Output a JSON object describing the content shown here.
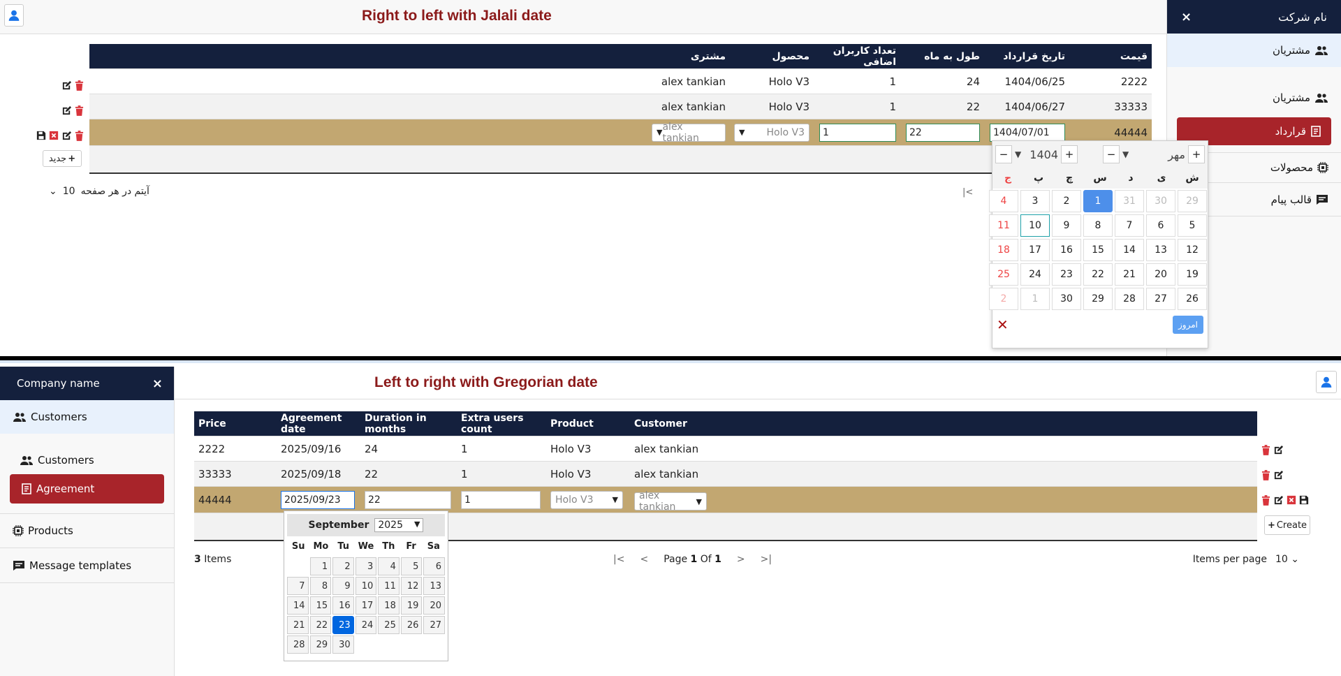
{
  "top": {
    "title": "Right to left with Jalali date",
    "sidebar": {
      "company": "نام شرکت",
      "close": "×",
      "nav_customers": "مشتریان",
      "sub_customers": "مشتریان",
      "sub_agreement": "قرارداد",
      "nav_products": "محصولات",
      "nav_messages": "قالب پیام"
    },
    "grid": {
      "headers": [
        "قیمت",
        "تاریخ قرارداد",
        "طول به ماه",
        "تعداد کاربران اضافی",
        "محصول",
        "مشتری"
      ],
      "rows": [
        [
          "2222",
          "1404/06/25",
          "24",
          "1",
          "Holo V3",
          "alex tankian"
        ],
        [
          "33333",
          "1404/06/27",
          "22",
          "1",
          "Holo V3",
          "alex tankian"
        ]
      ],
      "edit": {
        "price": "44444",
        "date": "1404/07/01",
        "duration": "22",
        "extra": "1",
        "product": "Holo V3",
        "customer": "alex tankian"
      }
    },
    "new_button": "جدید",
    "items_per_page_label": "آیتم در هر صفحه",
    "items_per_page": "10",
    "picker": {
      "month": "مهر",
      "year": "1404",
      "days": [
        "ش",
        "ی",
        "د",
        "س",
        "چ",
        "پ",
        "ج"
      ],
      "today": "امروز",
      "close": "✕",
      "weeks": [
        [
          "29",
          "30",
          "31",
          "1",
          "2",
          "3",
          "4"
        ],
        [
          "5",
          "6",
          "7",
          "8",
          "9",
          "10",
          "11"
        ],
        [
          "12",
          "13",
          "14",
          "15",
          "16",
          "17",
          "18"
        ],
        [
          "19",
          "20",
          "21",
          "22",
          "23",
          "24",
          "25"
        ],
        [
          "26",
          "27",
          "28",
          "29",
          "30",
          "1",
          "2"
        ]
      ]
    }
  },
  "bottom": {
    "title": "Left to right with Gregorian date",
    "sidebar": {
      "company": "Company name",
      "close": "×",
      "nav_customers": "Customers",
      "sub_customers": "Customers",
      "sub_agreement": "Agreement",
      "nav_products": "Products",
      "nav_messages": "Message templates"
    },
    "grid": {
      "headers": [
        "Price",
        "Agreement date",
        "Duration in months",
        "Extra users count",
        "Product",
        "Customer"
      ],
      "rows": [
        [
          "2222",
          "2025/09/16",
          "24",
          "1",
          "Holo V3",
          "alex tankian"
        ],
        [
          "33333",
          "2025/09/18",
          "22",
          "1",
          "Holo V3",
          "alex tankian"
        ]
      ],
      "edit": {
        "price": "44444",
        "date": "2025/09/23",
        "duration": "22",
        "extra": "1",
        "product": "Holo V3",
        "customer": "alex tankian"
      }
    },
    "create_button": "Create",
    "pager": {
      "count": "3",
      "items_label": "Items",
      "page_label": "Page",
      "page": "1",
      "of_label": "Of",
      "pages": "1",
      "ipp_label": "Items per page",
      "ipp": "10"
    },
    "picker": {
      "month": "September",
      "year": "2025",
      "days": [
        "Su",
        "Mo",
        "Tu",
        "We",
        "Th",
        "Fr",
        "Sa"
      ],
      "weeks": [
        [
          "",
          "1",
          "2",
          "3",
          "4",
          "5",
          "6"
        ],
        [
          "7",
          "8",
          "9",
          "10",
          "11",
          "12",
          "13"
        ],
        [
          "14",
          "15",
          "16",
          "17",
          "18",
          "19",
          "20"
        ],
        [
          "21",
          "22",
          "23",
          "24",
          "25",
          "26",
          "27"
        ],
        [
          "28",
          "29",
          "30",
          "",
          "",
          "",
          ""
        ]
      ]
    }
  },
  "colors": {
    "navy": "#14203d",
    "agreement_red": "#a8242a",
    "edit_row": "#c2a771",
    "title_red": "#8b1a1a",
    "selected_blue": "#4d8fea"
  }
}
